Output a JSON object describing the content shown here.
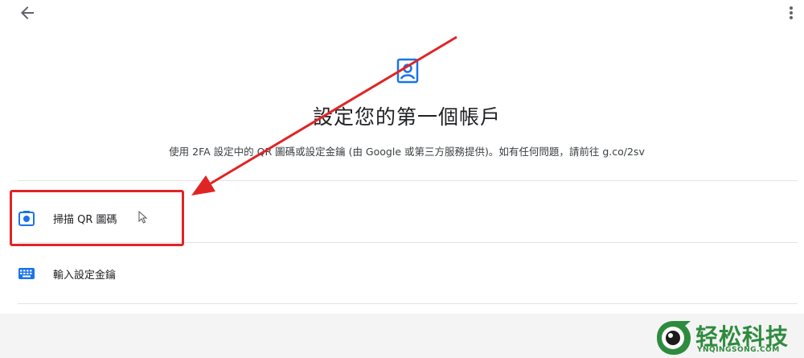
{
  "header": {
    "back_icon": "arrow-back-icon",
    "menu_icon": "more-vert-icon"
  },
  "main": {
    "icon": "authenticator-icon",
    "title": "設定您的第一個帳戶",
    "description": "使用 2FA 設定中的 QR 圖碼或設定金鑰 (由 Google 或第三方服務提供)。如有任何問題，請前往 g.co/2sv"
  },
  "options": [
    {
      "label": "掃描 QR 圖碼",
      "icon": "camera-icon"
    },
    {
      "label": "輸入設定金鑰",
      "icon": "keyboard-icon"
    }
  ],
  "watermark": {
    "text": "轻松科技",
    "domain": "YNQINGSONG.COM"
  },
  "colors": {
    "accent": "#1a73e8",
    "annotation": "#e02424",
    "watermark": "#2e8b3e"
  }
}
